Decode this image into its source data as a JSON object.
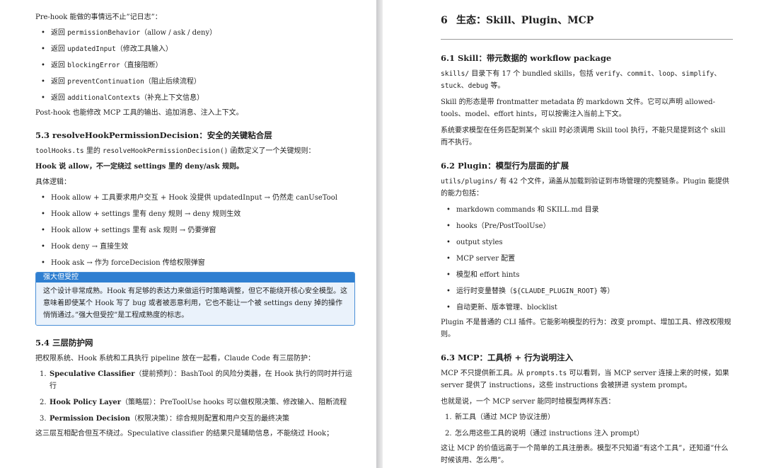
{
  "left": {
    "intro": "Pre-hook 能做的事情远不止”记日志”：",
    "prehook_items": [
      {
        "pre": "返回 ",
        "code": "permissionBehavior",
        "post": "（allow / ask / deny）"
      },
      {
        "pre": "返回 ",
        "code": "updatedInput",
        "post": "（修改工具输入）"
      },
      {
        "pre": "返回 ",
        "code": "blockingError",
        "post": "（直接阻断）"
      },
      {
        "pre": "返回 ",
        "code": "preventContinuation",
        "post": "（阻止后续流程）"
      },
      {
        "pre": "返回 ",
        "code": "additionalContexts",
        "post": "（补充上下文信息）"
      }
    ],
    "posthook": "Post-hook 也能修改 MCP 工具的输出、追加消息、注入上下文。",
    "s53": {
      "num": "5.3",
      "title": "resolveHookPermissionDecision：安全的关键粘合层",
      "p1_code1": "toolHooks.ts",
      "p1_mid": " 里的 ",
      "p1_code2": "resolveHookPermissionDecision()",
      "p1_post": " 函数定义了一个关键规则：",
      "rule": "Hook 说 allow，不一定绕过 settings 里的 deny/ask 规则。",
      "logic_label": "具体逻辑：",
      "logic_items": [
        "Hook allow + 工具要求用户交互 + Hook 没提供 updatedInput → 仍然走 canUseTool",
        "Hook allow + settings 里有 deny 规则 → deny 规则生效",
        "Hook allow + settings 里有 ask 规则 → 仍要弹窗",
        "Hook deny → 直接生效",
        "Hook ask → 作为 forceDecision 传给权限弹窗"
      ]
    },
    "callout": {
      "title": "强大但受控",
      "body": "这个设计非常成熟。Hook 有足够的表达力来做运行时策略调整，但它不能绕开核心安全模型。这意味着即使某个 Hook 写了 bug 或者被恶意利用，它也不能让一个被 settings deny 掉的操作悄悄通过。”强大但受控”是工程成熟度的标志。"
    },
    "s54": {
      "num": "5.4",
      "title": "三层防护网",
      "intro": "把权限系统、Hook 系统和工具执行 pipeline 放在一起看，Claude Code 有三层防护：",
      "items": [
        {
          "marker": "1.",
          "bold": "Speculative Classifier",
          "rest": "（提前预判）：BashTool 的风险分类器，在 Hook 执行的同时并行运行"
        },
        {
          "marker": "2.",
          "bold": "Hook Policy Layer",
          "rest": "（策略层）：PreToolUse hooks 可以做权限决策、修改输入、阻断流程"
        },
        {
          "marker": "3.",
          "bold": "Permission Decision",
          "rest": "（权限决策）：综合规则配置和用户交互的最终决策"
        }
      ],
      "tail": "这三层互相配合但互不绕过。Speculative classifier 的结果只是辅助信息，不能绕过 Hook；"
    }
  },
  "right": {
    "chapter": {
      "num": "6",
      "title": "生态：Skill、Plugin、MCP"
    },
    "s61": {
      "num": "6.1",
      "title": "Skill：带元数据的 workflow package",
      "p1_code": "skills/",
      "p1_a": " 目录下有 17 个 bundled skills，包括 ",
      "p1_list": [
        "verify",
        "commit",
        "loop",
        "simplify",
        "stuck"
      ],
      "p1_sep": "、",
      "p1_end_code": "debug",
      "p1_end": " 等。",
      "p2": "Skill 的形态是带 frontmatter metadata 的 markdown 文件。它可以声明 allowed-tools、model、effort hints，可以按需注入当前上下文。",
      "p3": "系统要求模型在任务匹配到某个 skill 时必须调用 Skill tool 执行，不能只是提到这个 skill 而不执行。"
    },
    "s62": {
      "num": "6.2",
      "title": "Plugin：模型行为层面的扩展",
      "p1_code": "utils/plugins/",
      "p1_rest": " 有 42 个文件，涵盖从加载到验证到市场管理的完整链条。Plugin 能提供的能力包括：",
      "items": [
        {
          "pre": "markdown commands 和 SKILL.md 目录",
          "code": "",
          "post": ""
        },
        {
          "pre": "hooks（Pre/PostToolUse）",
          "code": "",
          "post": ""
        },
        {
          "pre": "output styles",
          "code": "",
          "post": ""
        },
        {
          "pre": "MCP server 配置",
          "code": "",
          "post": ""
        },
        {
          "pre": "模型和 effort hints",
          "code": "",
          "post": ""
        },
        {
          "pre": "运行时变量替换（",
          "code": "${CLAUDE_PLUGIN_ROOT}",
          "post": " 等）"
        },
        {
          "pre": "自动更新、版本管理、blocklist",
          "code": "",
          "post": ""
        }
      ],
      "p2": "Plugin 不是普通的 CLI 插件。它能影响模型的行为：改变 prompt、增加工具、修改权限规则。"
    },
    "s63": {
      "num": "6.3",
      "title": "MCP：工具桥 + 行为说明注入",
      "p1_pre": "MCP 不只提供新工具。从 ",
      "p1_code": "prompts.ts",
      "p1_post": " 可以看到，当 MCP server 连接上来的时候，如果 server 提供了 instructions，这些 instructions 会被拼进 system prompt。",
      "p2": "也就是说，一个 MCP server 能同时给模型两样东西：",
      "items": [
        {
          "marker": "1.",
          "text": "新工具（通过 MCP 协议注册）"
        },
        {
          "marker": "2.",
          "text": "怎么用这些工具的说明（通过 instructions 注入 prompt）"
        }
      ],
      "p3": "这让 MCP 的价值远高于一个简单的工具注册表。模型不只知道”有这个工具”，还知道”什么时候该用、怎么用”。"
    }
  }
}
